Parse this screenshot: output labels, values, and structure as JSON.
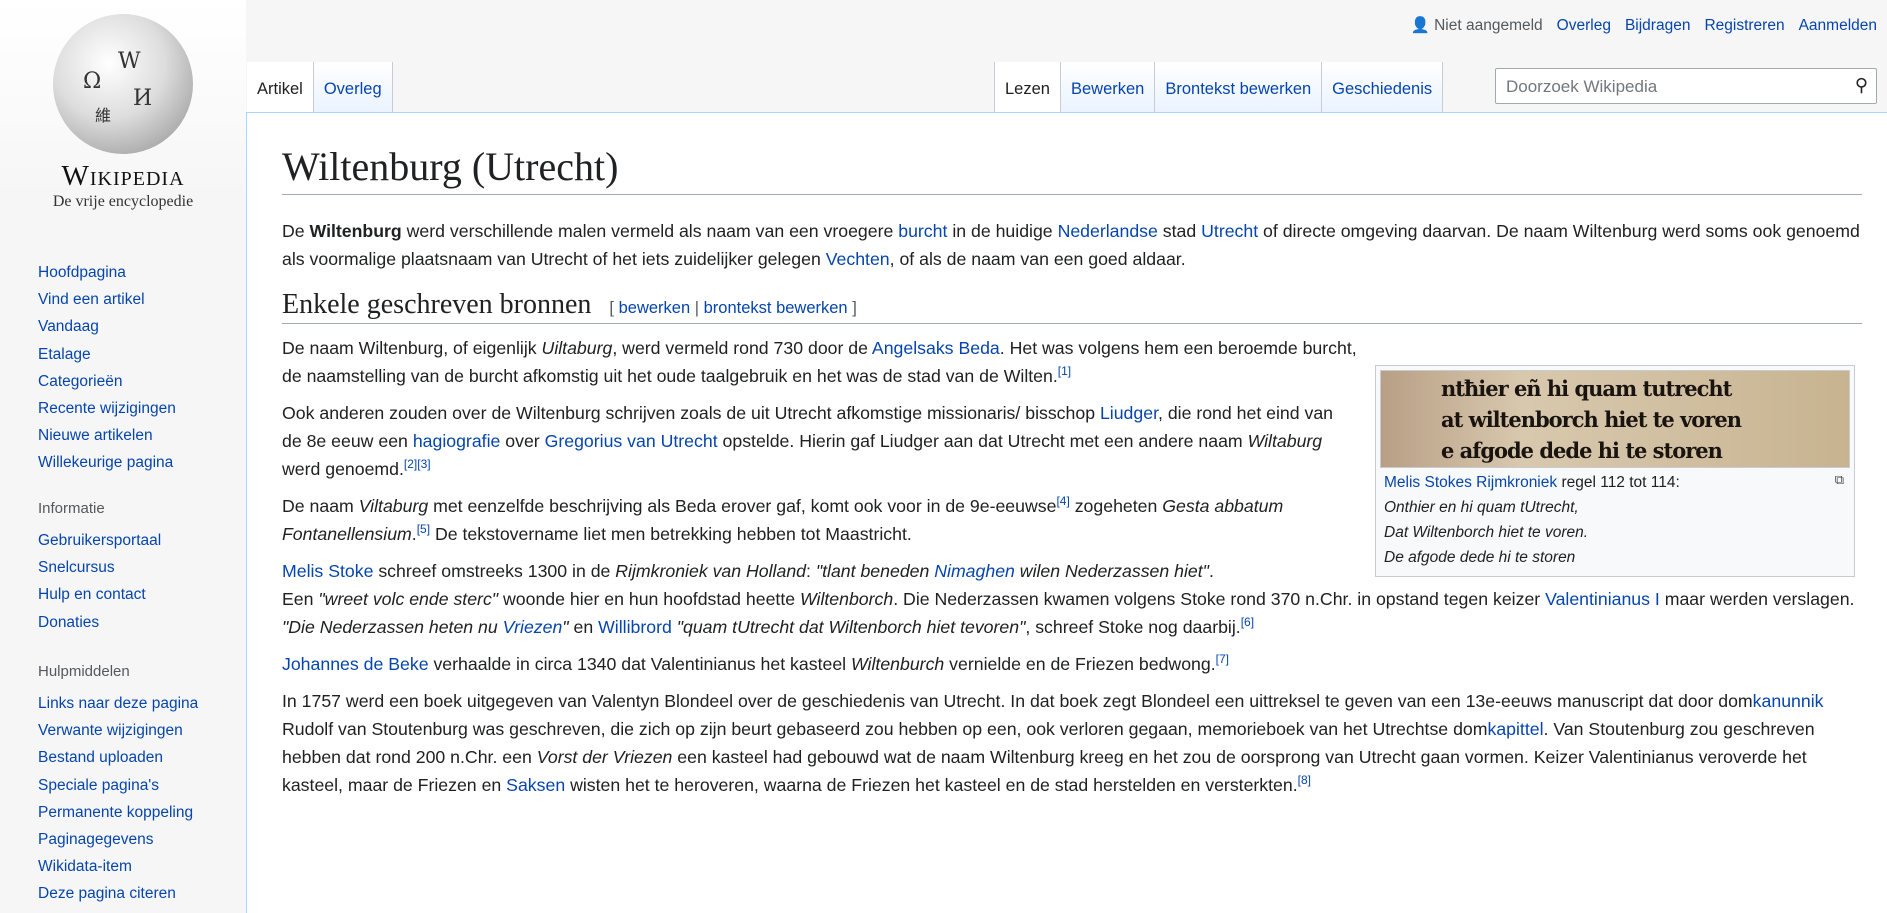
{
  "logo": {
    "wordmark": "Wikipedia",
    "tagline": "De vrije encyclopedie"
  },
  "personal": {
    "anon": "Niet aangemeld",
    "links": [
      "Overleg",
      "Bijdragen",
      "Registreren",
      "Aanmelden"
    ]
  },
  "tabs_left": [
    "Artikel",
    "Overleg"
  ],
  "tabs_right": [
    "Lezen",
    "Bewerken",
    "Brontekst bewerken",
    "Geschiedenis"
  ],
  "search": {
    "placeholder": "Doorzoek Wikipedia"
  },
  "nav": [
    "Hoofdpagina",
    "Vind een artikel",
    "Vandaag",
    "Etalage",
    "Categorieën",
    "Recente wijzigingen",
    "Nieuwe artikelen",
    "Willekeurige pagina"
  ],
  "info": {
    "title": "Informatie",
    "items": [
      "Gebruikersportaal",
      "Snelcursus",
      "Hulp en contact",
      "Donaties"
    ]
  },
  "tools": {
    "title": "Hulpmiddelen",
    "items": [
      "Links naar deze pagina",
      "Verwante wijzigingen",
      "Bestand uploaden",
      "Speciale pagina's",
      "Permanente koppeling",
      "Paginagegevens",
      "Wikidata-item",
      "Deze pagina citeren"
    ]
  },
  "title": "Wiltenburg (Utrecht)",
  "section": {
    "heading": "Enkele geschreven bronnen",
    "edit": "bewerken",
    "source_edit": "brontekst bewerken"
  },
  "thumb": {
    "manuscript": [
      "ntħier eñ hi quam tutrecht",
      "at wiltenborch hiet te voren",
      "e afgode dede hi te storen"
    ],
    "link": "Melis Stokes Rijmkroniek",
    "caption": " regel 112 tot 114:",
    "lines": [
      "Onthier en hi quam tUtrecht,",
      "Dat Wiltenborch hiet te voren.",
      "De afgode dede hi te storen"
    ]
  },
  "intro": [
    [
      "t",
      "De "
    ],
    [
      "b",
      "Wiltenburg"
    ],
    [
      "t",
      " werd verschillende malen vermeld als naam van een vroegere "
    ],
    [
      "a",
      "burcht"
    ],
    [
      "t",
      " in de huidige "
    ],
    [
      "a",
      "Nederlandse"
    ],
    [
      "t",
      " stad "
    ],
    [
      "a",
      "Utrecht"
    ],
    [
      "t",
      " of directe omgeving daarvan. De naam Wiltenburg werd soms ook genoemd als voormalige plaatsnaam van Utrecht of het iets zuidelijker gelegen "
    ],
    [
      "a",
      "Vechten"
    ],
    [
      "t",
      ", of als de naam van een goed aldaar."
    ]
  ],
  "paragraphs": [
    [
      [
        "t",
        "De naam Wiltenburg, of eigenlijk "
      ],
      [
        "i",
        "Uiltaburg"
      ],
      [
        "t",
        ", werd vermeld rond 730 door de "
      ],
      [
        "a",
        "Angelsaks Beda"
      ],
      [
        "t",
        ". Het was volgens hem een beroemde burcht, de naamstelling van de burcht afkomstig uit het oude taalgebruik en het was de stad van de Wilten."
      ],
      [
        "s",
        "[1]"
      ]
    ],
    [
      [
        "t",
        "Ook anderen zouden over de Wiltenburg schrijven zoals de uit Utrecht afkomstige missionaris/ bisschop "
      ],
      [
        "a",
        "Liudger"
      ],
      [
        "t",
        ", die rond het eind van de 8e eeuw een "
      ],
      [
        "a",
        "hagiografie"
      ],
      [
        "t",
        " over "
      ],
      [
        "a",
        "Gregorius van Utrecht"
      ],
      [
        "t",
        " opstelde. Hierin gaf Liudger aan dat Utrecht met een andere naam "
      ],
      [
        "i",
        "Wiltaburg"
      ],
      [
        "t",
        " werd genoemd."
      ],
      [
        "s",
        "[2]"
      ],
      [
        "s",
        "[3]"
      ]
    ],
    [
      [
        "t",
        "De naam "
      ],
      [
        "i",
        "Viltaburg"
      ],
      [
        "t",
        " met eenzelfde beschrijving als Beda erover gaf, komt ook voor in de 9e-eeuwse"
      ],
      [
        "s",
        "[4]"
      ],
      [
        "t",
        " zogeheten "
      ],
      [
        "i",
        "Gesta abbatum Fontanellensium"
      ],
      [
        "t",
        "."
      ],
      [
        "s",
        "[5]"
      ],
      [
        "t",
        " De tekstovername liet men betrekking hebben tot Maastricht."
      ]
    ],
    [
      [
        "a",
        "Melis Stoke"
      ],
      [
        "t",
        " schreef omstreeks 1300 in de "
      ],
      [
        "i",
        "Rijmkroniek van Holland"
      ],
      [
        "t",
        ": "
      ],
      [
        "i",
        "\"tlant beneden "
      ],
      [
        "ai",
        "Nimaghen"
      ],
      [
        "i",
        " wilen Nederzassen hiet\""
      ],
      [
        "t",
        ". "
      ],
      [
        "br",
        ""
      ],
      [
        "t",
        "Een "
      ],
      [
        "i",
        "\"wreet volc ende sterc\""
      ],
      [
        "t",
        " woonde hier en hun hoofdstad heette "
      ],
      [
        "i",
        "Wiltenborch"
      ],
      [
        "t",
        ". Die Nederzassen kwamen volgens Stoke rond 370 n.Chr. in opstand tegen keizer "
      ],
      [
        "a",
        "Valentinianus I"
      ],
      [
        "t",
        " maar werden verslagen. "
      ],
      [
        "i",
        "\"Die Nederzassen heten nu "
      ],
      [
        "ai",
        "Vriezen"
      ],
      [
        "i",
        "\""
      ],
      [
        "t",
        " en "
      ],
      [
        "a",
        "Willibrord"
      ],
      [
        "t",
        " "
      ],
      [
        "i",
        "\"quam tUtrecht dat Wiltenborch hiet tevoren\""
      ],
      [
        "t",
        ", schreef Stoke nog daarbij."
      ],
      [
        "s",
        "[6]"
      ]
    ],
    [
      [
        "a",
        "Johannes de Beke"
      ],
      [
        "t",
        " verhaalde in circa 1340 dat Valentinianus het kasteel "
      ],
      [
        "i",
        "Wiltenburch"
      ],
      [
        "t",
        " vernielde en de Friezen bedwong."
      ],
      [
        "s",
        "[7]"
      ]
    ],
    [
      [
        "t",
        "In 1757 werd een boek uitgegeven van Valentyn Blondeel over de geschiedenis van Utrecht. In dat boek zegt Blondeel een uittreksel te geven van een 13e-eeuws manuscript dat door dom"
      ],
      [
        "a",
        "kanunnik"
      ],
      [
        "t",
        " Rudolf van Stoutenburg was geschreven, die zich op zijn beurt gebaseerd zou hebben op een, ook verloren gegaan, memorieboek van het Utrechtse dom"
      ],
      [
        "a",
        "kapittel"
      ],
      [
        "t",
        ". Van Stoutenburg zou geschreven hebben dat rond 200 n.Chr. een "
      ],
      [
        "i",
        "Vorst der Vriezen"
      ],
      [
        "t",
        " een kasteel had gebouwd wat de naam Wiltenburg kreeg en het zou de oorsprong van Utrecht gaan vormen. Keizer Valentinianus veroverde het kasteel, maar de Friezen en "
      ],
      [
        "a",
        "Saksen"
      ],
      [
        "t",
        " wisten het te heroveren, waarna de Friezen het kasteel en de stad herstelden en versterkten."
      ],
      [
        "s",
        "[8]"
      ]
    ]
  ]
}
